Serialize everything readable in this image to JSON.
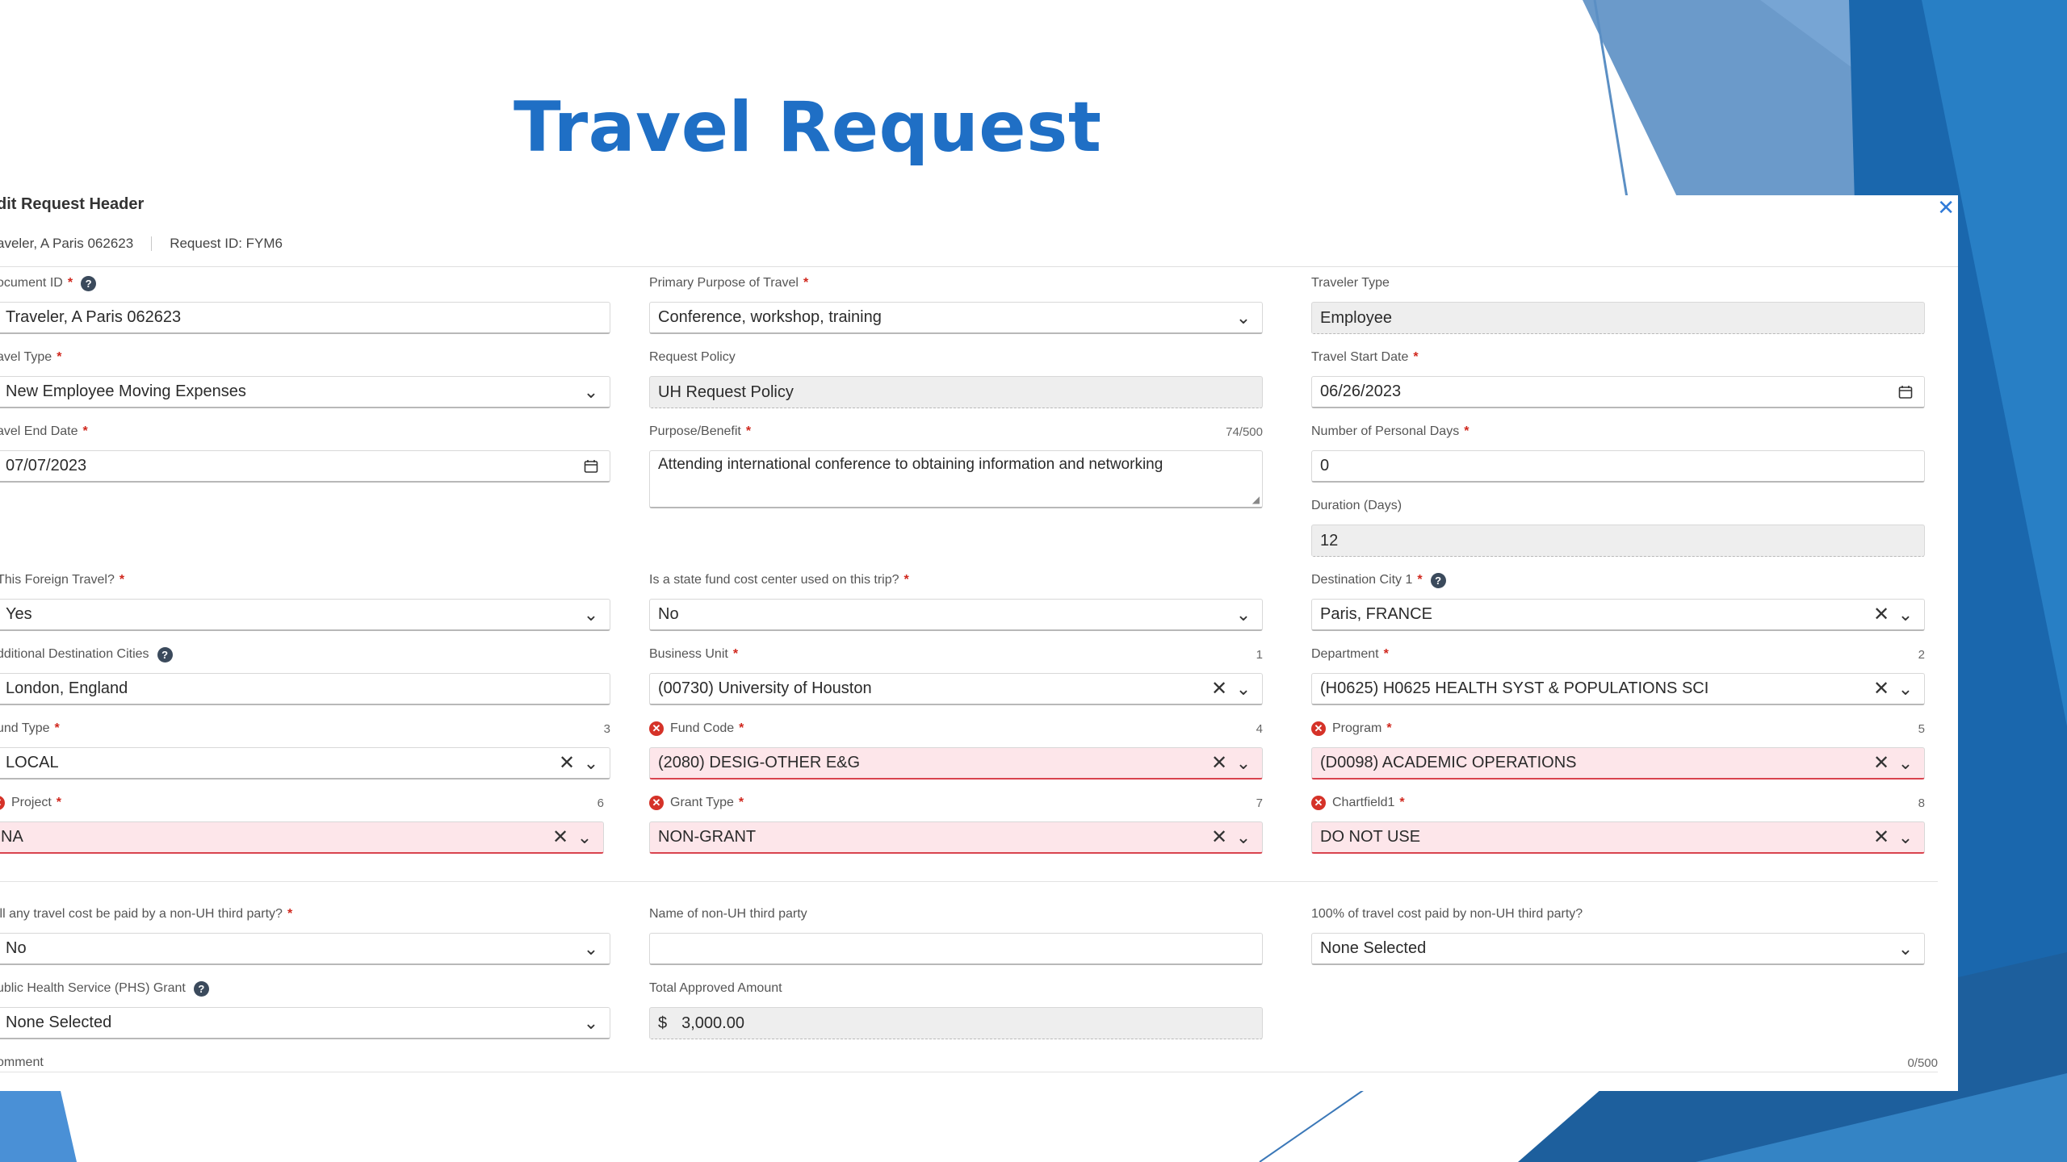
{
  "slide": {
    "title": "Travel Request"
  },
  "form": {
    "title": "dit Request Header",
    "traveler": "aveler, A Paris 062623",
    "request_id": "Request ID: FYM6",
    "close_glyph": "✕"
  },
  "fields": {
    "document_id": {
      "label": "ocument ID",
      "value": "Traveler, A Paris 062623"
    },
    "primary_purpose": {
      "label": "Primary Purpose of Travel",
      "value": "Conference, workshop, training"
    },
    "traveler_type": {
      "label": "Traveler Type",
      "value": "Employee"
    },
    "travel_type": {
      "label": "avel Type",
      "value": "New Employee Moving Expenses"
    },
    "request_policy": {
      "label": "Request Policy",
      "value": "UH Request Policy"
    },
    "travel_start_date": {
      "label": "Travel Start Date",
      "value": "06/26/2023"
    },
    "travel_end_date": {
      "label": "avel End Date",
      "value": "07/07/2023"
    },
    "purpose_benefit": {
      "label": "Purpose/Benefit",
      "count": "74/500",
      "value": "Attending international conference to obtaining information and networking"
    },
    "personal_days": {
      "label": "Number of Personal Days",
      "value": "0"
    },
    "duration": {
      "label": "Duration (Days)",
      "value": "12"
    },
    "foreign_travel": {
      "label": "This Foreign Travel?",
      "value": "Yes"
    },
    "state_fund": {
      "label": "Is a state fund cost center used on this trip?",
      "value": "No"
    },
    "destination_city": {
      "label": "Destination City 1",
      "value": "Paris, FRANCE"
    },
    "additional_cities": {
      "label": "dditional Destination Cities",
      "value": "London, England"
    },
    "business_unit": {
      "label": "Business Unit",
      "count": "1",
      "value": "(00730) University of Houston"
    },
    "department": {
      "label": "Department",
      "count": "2",
      "value": "(H0625) H0625 HEALTH SYST & POPULATIONS SCI"
    },
    "fund_type": {
      "label": "und Type",
      "count": "3",
      "value": "LOCAL"
    },
    "fund_code": {
      "label": "Fund Code",
      "count": "4",
      "value": "(2080) DESIG-OTHER E&G"
    },
    "program": {
      "label": "Program",
      "count": "5",
      "value": "(D0098) ACADEMIC OPERATIONS"
    },
    "project": {
      "label": "Project",
      "count": "6",
      "value": "NA"
    },
    "grant_type": {
      "label": "Grant Type",
      "count": "7",
      "value": "NON-GRANT"
    },
    "chartfield1": {
      "label": "Chartfield1",
      "count": "8",
      "value": "DO NOT USE"
    },
    "third_party": {
      "label": "ill any travel cost be paid by a non-UH third party?",
      "value": "No"
    },
    "third_party_name": {
      "label": "Name of non-UH third party",
      "value": ""
    },
    "third_party_full": {
      "label": "100% of travel cost paid by non-UH third party?",
      "value": "None Selected"
    },
    "phs_grant": {
      "label": "ublic Health Service (PHS) Grant",
      "value": "None Selected"
    },
    "total_approved": {
      "label": "Total Approved Amount",
      "currency": "$",
      "value": "3,000.00"
    },
    "comment": {
      "label": "omment",
      "count": "0/500"
    }
  },
  "glyphs": {
    "chevron": "⌄",
    "clear": "✕",
    "calendar": "📅",
    "help": "?",
    "error": "✕",
    "required": "*"
  },
  "colors": {
    "title_blue": "#1f6fc5",
    "error_bg": "#fde6ea",
    "error_red": "#d53228",
    "deco_blue": "#1a67ad"
  }
}
